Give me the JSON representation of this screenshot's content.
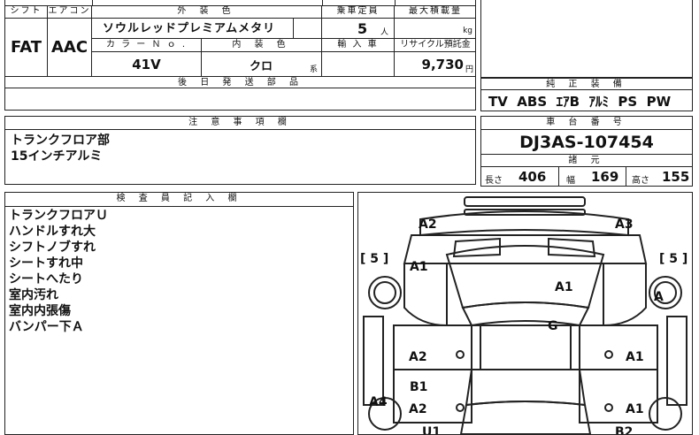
{
  "vehicle_table": {
    "shift_label": "シフト",
    "aircon_label": "エアコン",
    "exterior_label": "外 装 色",
    "seating_label": "乗車定員",
    "maxload_label": "最大積載量",
    "shift_value": "FAT",
    "aircon_value": "AAC",
    "exterior_value": "ソウルレッドプレミアムメタリ",
    "seating_value": "5",
    "seating_unit": "人",
    "maxload_unit": "kg",
    "color_no_label": "カ ラ ー Ｎ ｏ .",
    "interior_label": "内 装 色",
    "import_label": "輸 入 車",
    "recycle_label": "リサイクル預託金",
    "color_no_value": "41V",
    "interior_value": "クロ",
    "interior_suffix": "系",
    "recycle_value": "9,730",
    "recycle_unit": "円",
    "later_parts_label": "後 日 発 送 部 品"
  },
  "equipment": {
    "label": "純 正 装 備",
    "items": "TV  ABS  ｴｱB  ｱﾙﾐ  PS  PW"
  },
  "notes": {
    "label": "注 意 事 項 欄",
    "lines": [
      "トランクフロア部",
      "15インチアルミ"
    ]
  },
  "chassis": {
    "label": "車 台 番 号",
    "value": "DJ3AS-107454",
    "specs_label": "諸 元",
    "length_label": "長さ",
    "length_value": "406",
    "width_label": "幅",
    "width_value": "169",
    "height_label": "高さ",
    "height_value": "155"
  },
  "inspector": {
    "label": "検 査 員 記 入 欄",
    "lines": [
      "トランクフロアＵ",
      "ハンドルすれ大",
      "シフトノブすれ",
      "シートすれ中",
      "シートへたり",
      "室内汚れ",
      "室内内張傷",
      "バンパー下Ａ"
    ]
  },
  "diagram": {
    "marks": [
      "A2",
      "A3",
      "[ 5 ]",
      "[ 5 ]",
      "A1",
      "A1",
      "A",
      "G",
      "A2",
      "A1",
      "B1",
      "A2",
      "A1",
      "A4",
      "U1",
      "B2"
    ]
  }
}
